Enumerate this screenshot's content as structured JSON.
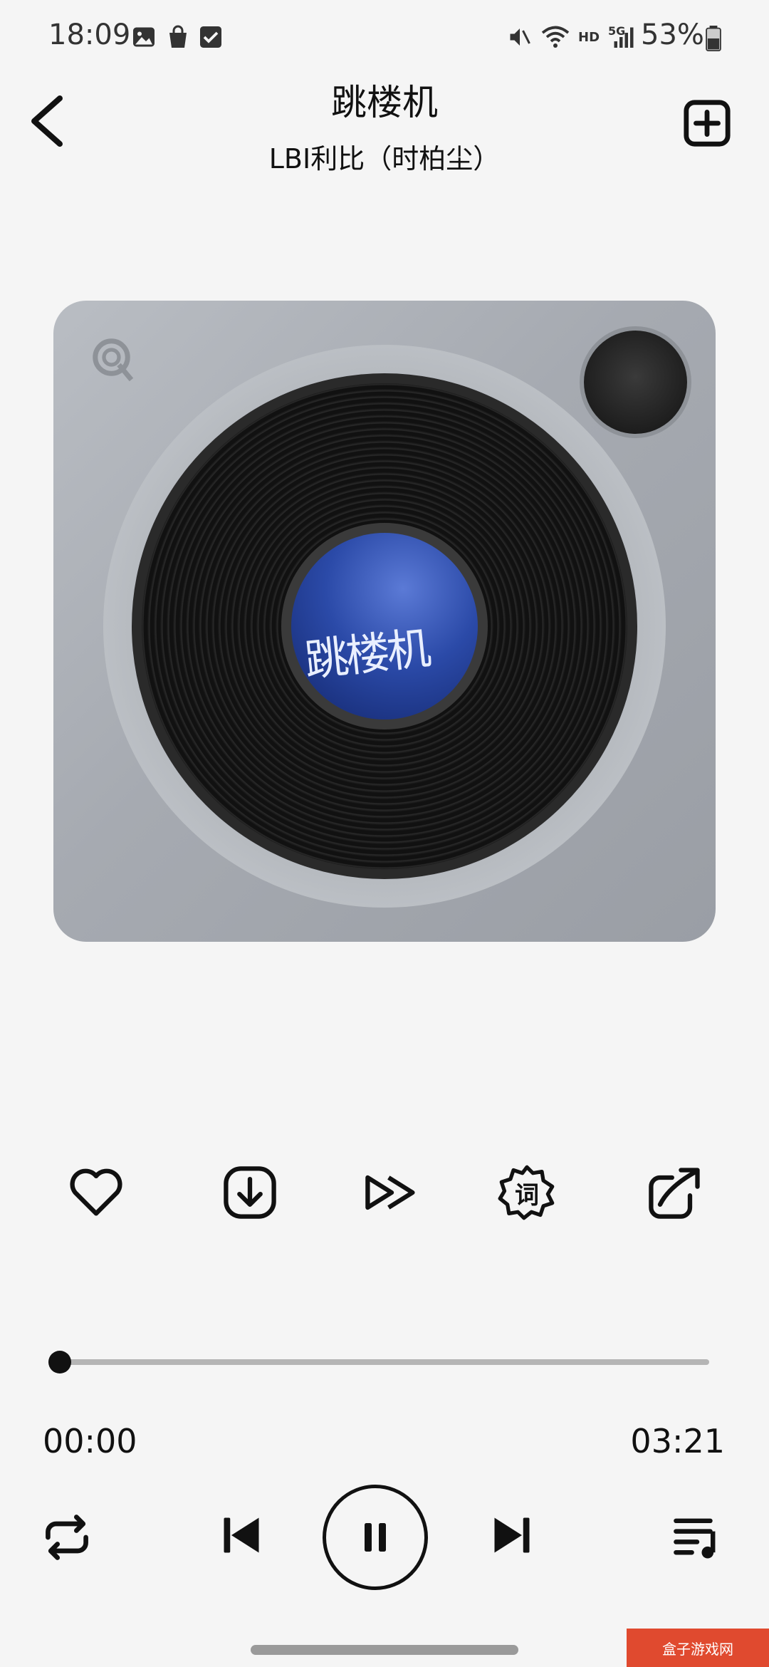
{
  "status_bar": {
    "time": "18:09",
    "network": "HD",
    "signal": "5G",
    "battery": "53%"
  },
  "header": {
    "title": "跳楼机",
    "artist": "LBI利比（时柏尘）"
  },
  "album": {
    "cover_text": "跳楼机"
  },
  "actions": [
    {
      "icon": "heart-icon"
    },
    {
      "icon": "download-icon"
    },
    {
      "icon": "fast-forward-icon"
    },
    {
      "icon": "lyrics-icon",
      "label": "词"
    },
    {
      "icon": "share-icon"
    }
  ],
  "progress": {
    "current": "00:00",
    "duration": "03:21",
    "fraction": 0
  },
  "controls": {
    "repeat": "repeat-icon",
    "previous": "previous-icon",
    "play_pause": "pause-icon",
    "next": "next-icon",
    "playlist": "playlist-icon"
  },
  "watermark": "盒子游戏网",
  "colors": {
    "background": "#f5f5f5",
    "foreground": "#111111",
    "progress_track": "#b5b5b5"
  }
}
